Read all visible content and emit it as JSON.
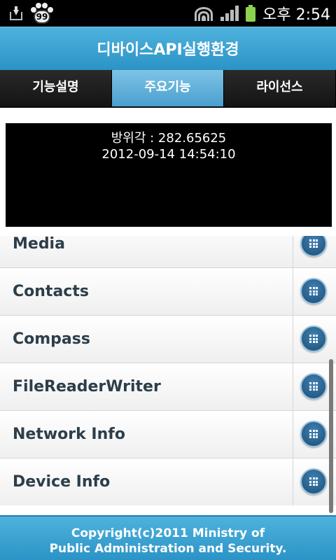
{
  "status_bar": {
    "notification_badge": "99",
    "time": "오후 2:54",
    "icons": [
      "download-icon",
      "paw-notification-icon",
      "wifi-icon",
      "signal-icon",
      "battery-icon"
    ],
    "battery_color": "#8bd24f"
  },
  "header": {
    "title": "디바이스API실행환경"
  },
  "tabs": [
    {
      "label": "기능설명",
      "active": false
    },
    {
      "label": "주요기능",
      "active": true
    },
    {
      "label": "라이선스",
      "active": false
    }
  ],
  "info": {
    "line1": "방위각 : 282.65625",
    "line2": "2012-09-14 14:54:10"
  },
  "list": {
    "items": [
      {
        "label": "Media",
        "icon": "grid-icon"
      },
      {
        "label": "Contacts",
        "icon": "grid-icon"
      },
      {
        "label": "Compass",
        "icon": "grid-icon"
      },
      {
        "label": "FileReaderWriter",
        "icon": "grid-icon"
      },
      {
        "label": "Network Info",
        "icon": "grid-icon"
      },
      {
        "label": "Device Info",
        "icon": "grid-icon"
      }
    ]
  },
  "footer": {
    "line1": "Copyright(c)2011 Ministry of",
    "line2": "Public Administration and Security."
  },
  "colors": {
    "header_blue": "#3aa3d3",
    "active_tab": "#6bb8e0",
    "tab_dark": "#1e1e1e",
    "list_text": "#2c3e4a"
  }
}
